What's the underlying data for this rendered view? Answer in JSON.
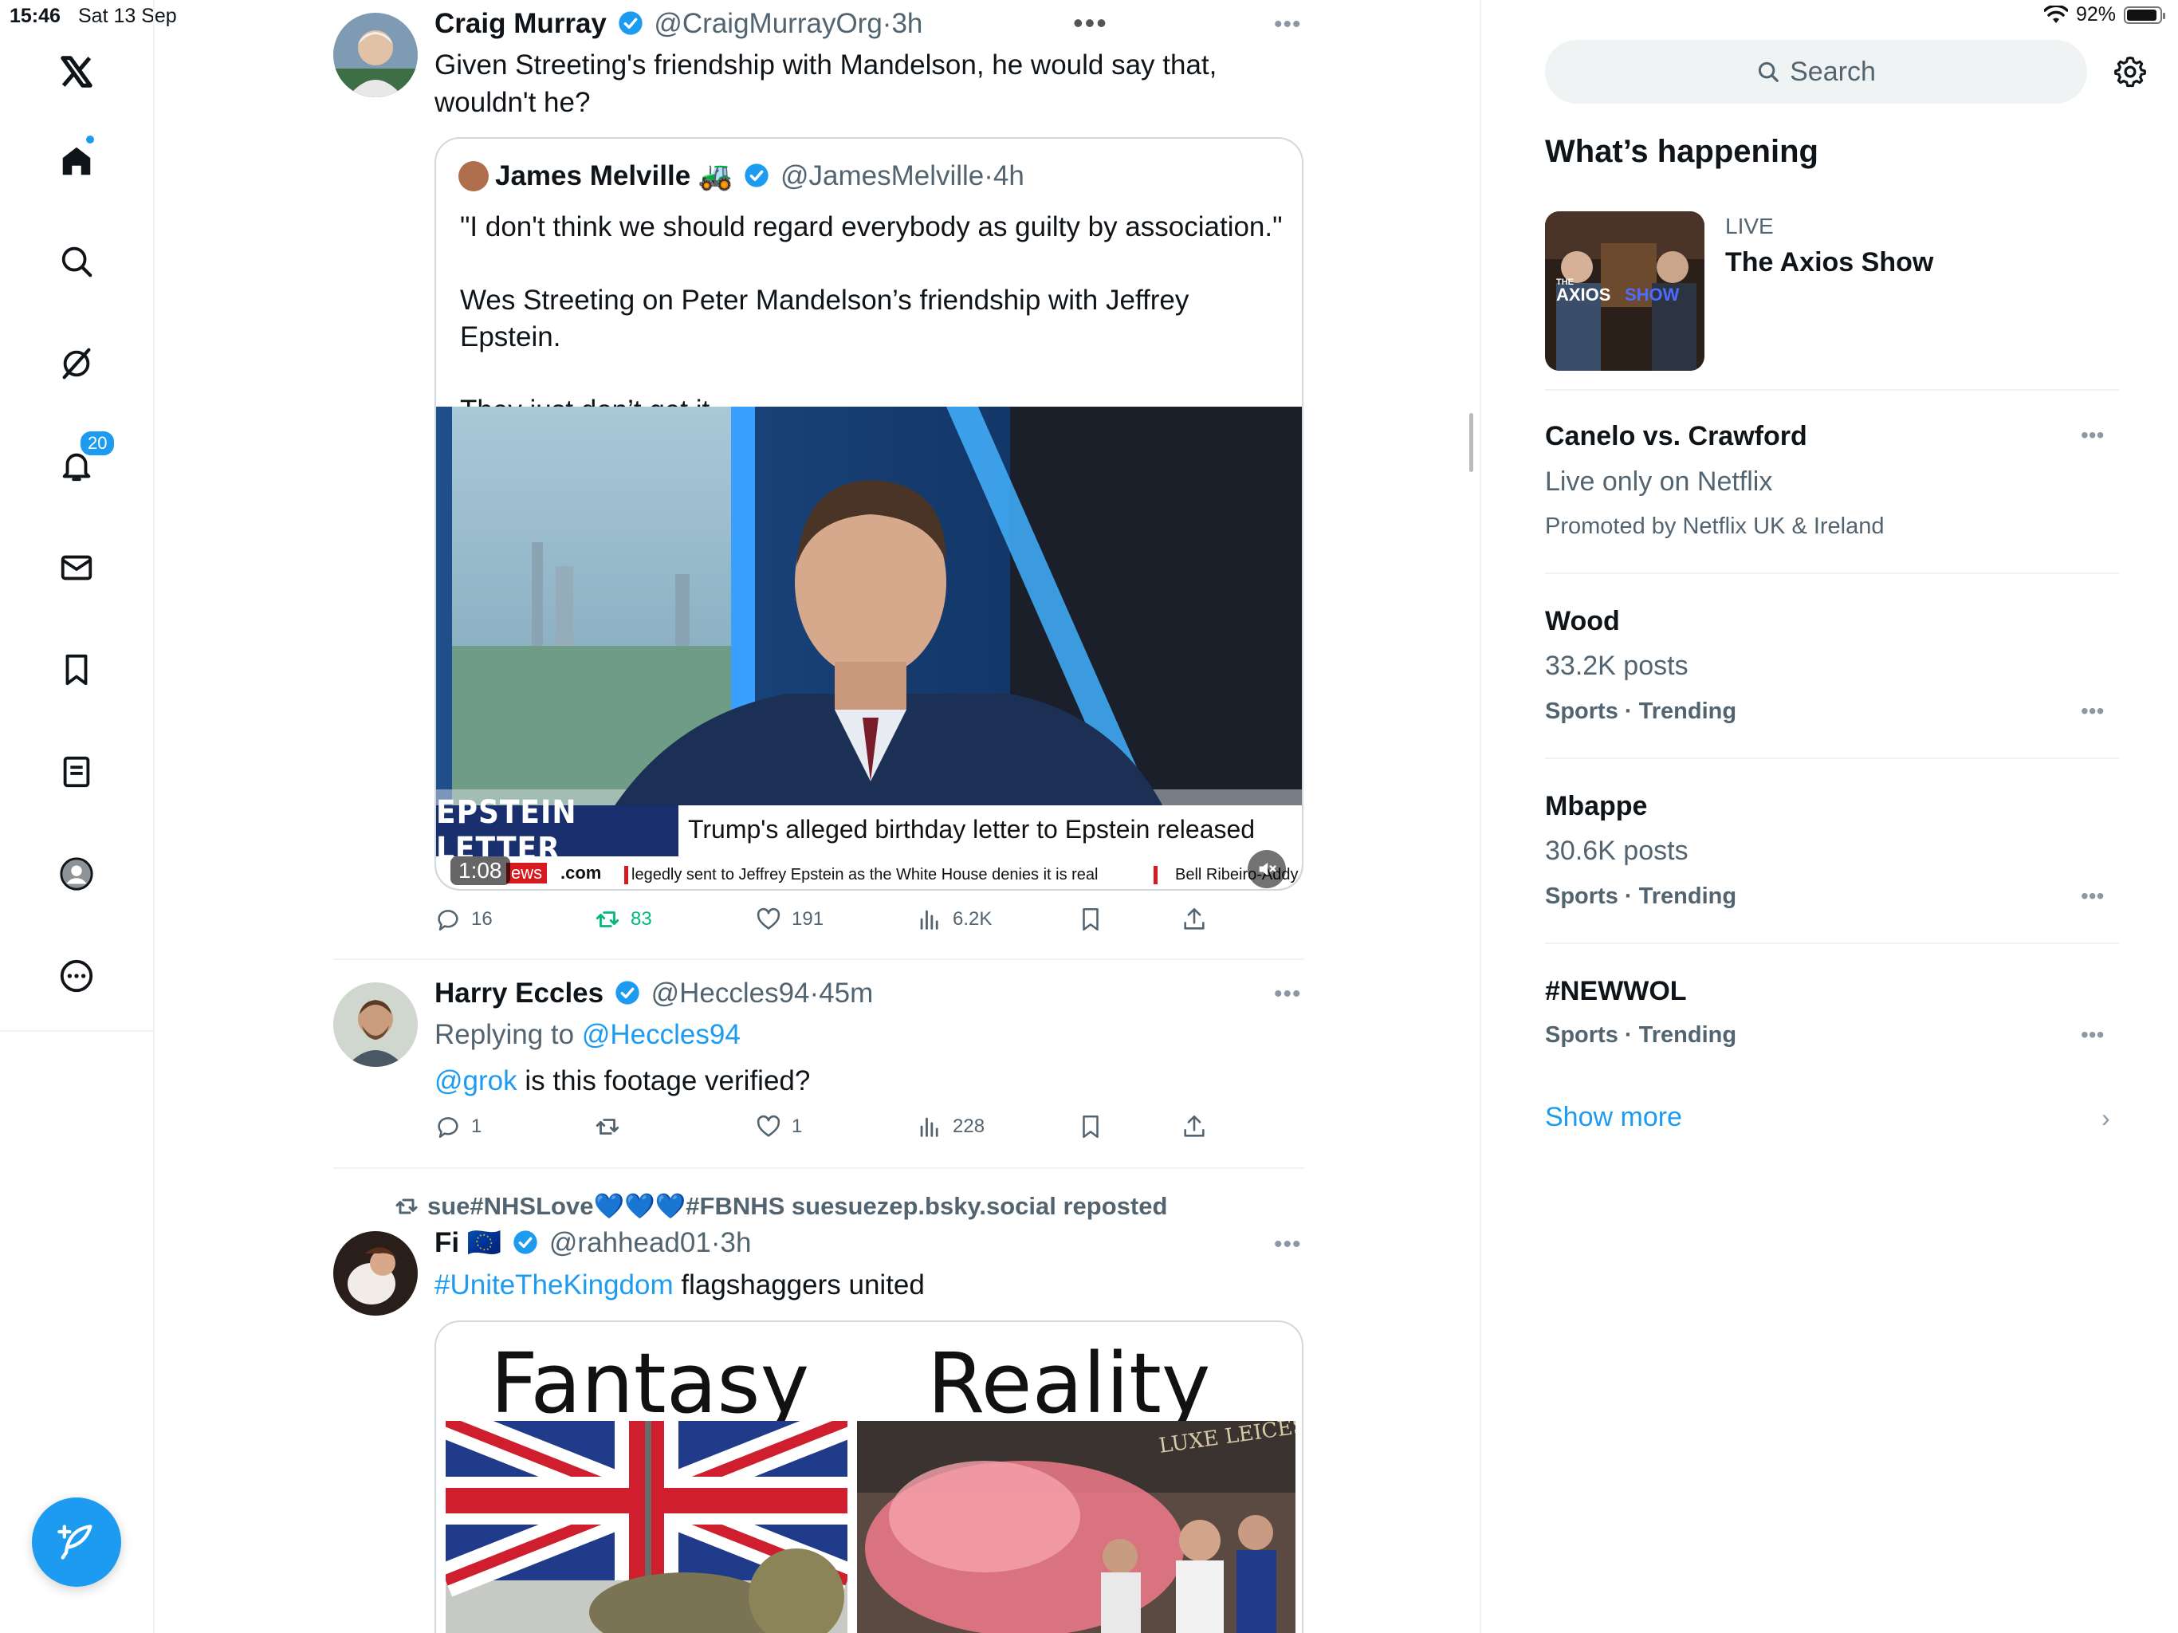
{
  "status_bar": {
    "time": "15:46",
    "date": "Sat 13 Sep",
    "battery": "92%",
    "battery_level": 0.92
  },
  "nav": {
    "notifications_badge": "20",
    "icons": [
      "x-logo-icon",
      "home-icon",
      "search-icon",
      "grok-icon",
      "bell-icon",
      "mail-icon",
      "bookmark-icon",
      "lists-icon",
      "profile-icon",
      "more-icon"
    ]
  },
  "colors": {
    "accent": "#1d9bf0",
    "retweet_green": "#00ba7c",
    "text": "#0f1419",
    "muted": "#536471"
  },
  "feed": {
    "tweet1": {
      "name": "Craig Murray",
      "handle": "@CraigMurrayOrg",
      "time": "3h",
      "text": "Given Streeting's friendship with Mandelson, he would say that, wouldn't he?",
      "quote": {
        "name": "James Melville",
        "emoji": "🚜",
        "handle": "@JamesMelville",
        "time": "4h",
        "line1": "\"I don't think we should regard everybody as guilty by association.\"",
        "line2": "Wes Streeting on Peter Mandelson’s friendship with Jeffrey Epstein.",
        "line3": "They just don’t get it.",
        "video": {
          "tag": "EPSTEIN LETTER",
          "headline": "Trump's alleged birthday letter to Epstein released",
          "ticker_logo": "ews",
          "ticker_logo2": ".com",
          "ticker1": "legedly sent to Jeffrey Epstein as the White House denies it is real",
          "ticker2": "Bell Ribeiro-Addy",
          "duration": "1:08"
        }
      },
      "stats": {
        "replies": "16",
        "reposts": "83",
        "likes": "191",
        "views": "6.2K"
      }
    },
    "tweet2": {
      "name": "Harry Eccles",
      "handle": "@Heccles94",
      "time": "45m",
      "replying_prefix": "Replying to",
      "replying_to": "@Heccles94",
      "mention": "@grok",
      "text": "is this footage verified?",
      "stats": {
        "replies": "1",
        "reposts": "",
        "likes": "1",
        "views": "228"
      }
    },
    "tweet3": {
      "reposted_by": "sue#NHSLove",
      "reposted_hearts": "💙💙💙",
      "reposted_suffix": "#FBNHS suesuezep.bsky.social reposted",
      "name": "Fi",
      "flag": "🇪🇺",
      "handle": "@rahhead01",
      "time": "3h",
      "hashtag": "#UniteTheKingdom",
      "text": "flagshaggers united",
      "meme_left": "Fantasy",
      "meme_right": "Reality",
      "sign_text": "LUXE LEICEST"
    }
  },
  "sidebar": {
    "search_placeholder": "Search",
    "section_title": "What’s happening",
    "live": {
      "label": "LIVE",
      "title": "The Axios Show",
      "thumb_small": "THE",
      "thumb_brand": "AXIOS",
      "thumb_brand2": "SHOW"
    },
    "trends": [
      {
        "title": "Canelo vs. Crawford",
        "sub": "Live only on Netflix",
        "meta": "Promoted by Netflix UK & Ireland"
      },
      {
        "title": "Wood",
        "sub": "33.2K posts",
        "meta": "Sports · Trending"
      },
      {
        "title": "Mbappe",
        "sub": "30.6K posts",
        "meta": "Sports · Trending"
      },
      {
        "title": "#NEWWOL",
        "sub": "",
        "meta": "Sports · Trending"
      }
    ],
    "show_more": "Show more"
  }
}
